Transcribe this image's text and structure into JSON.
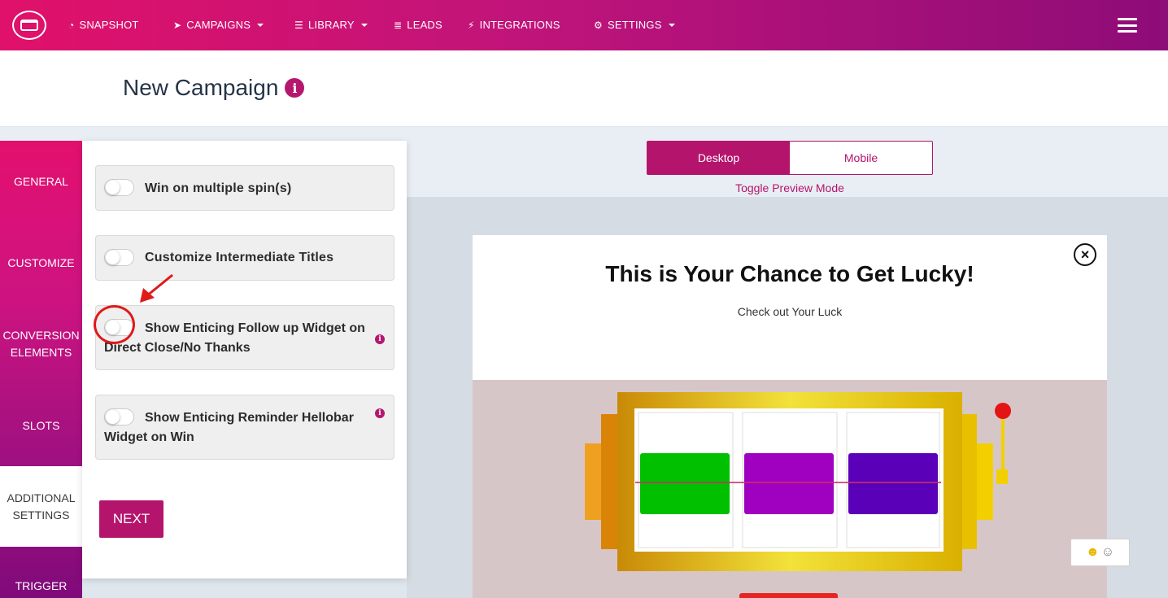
{
  "nav": {
    "items": [
      {
        "label": "SNAPSHOT",
        "icon": "dashboard-icon",
        "dropdown": false
      },
      {
        "label": "CAMPAIGNS",
        "icon": "paper-plane-icon",
        "dropdown": true
      },
      {
        "label": "LIBRARY",
        "icon": "library-icon",
        "dropdown": true
      },
      {
        "label": "LEADS",
        "icon": "list-icon",
        "dropdown": false
      },
      {
        "label": "INTEGRATIONS",
        "icon": "plug-icon",
        "dropdown": false
      },
      {
        "label": "SETTINGS",
        "icon": "cogs-icon",
        "dropdown": true
      }
    ]
  },
  "page": {
    "title": "New Campaign"
  },
  "sidebar": {
    "tabs": [
      {
        "label": "GENERAL",
        "active": false
      },
      {
        "label": "CUSTOMIZE",
        "active": false
      },
      {
        "label": "CONVERSION ELEMENTS",
        "active": false
      },
      {
        "label": "SLOTS",
        "active": false
      },
      {
        "label": "ADDITIONAL SETTINGS",
        "active": true
      },
      {
        "label": "TRIGGER",
        "active": false
      }
    ]
  },
  "settings": {
    "options": [
      {
        "label": "Win on multiple spin(s)",
        "enabled": false,
        "info": false
      },
      {
        "label": "Customize Intermediate Titles",
        "enabled": false,
        "info": false
      },
      {
        "label": "Show Enticing Follow up Widget on Direct Close/No Thanks",
        "enabled": false,
        "info": true
      },
      {
        "label": "Show Enticing Reminder Hellobar Widget on Win",
        "enabled": false,
        "info": true
      }
    ],
    "next_label": "NEXT"
  },
  "preview": {
    "desktop_label": "Desktop",
    "mobile_label": "Mobile",
    "mode": "desktop",
    "caption": "Toggle Preview Mode"
  },
  "popup": {
    "title": "This is Your Chance to Get Lucky!",
    "subtitle": "Check out Your Luck",
    "close_glyph": "×",
    "slot_colors": [
      "#00c000",
      "#a000c0",
      "#5a00b8"
    ]
  },
  "emoji_widget": {
    "glyph": "☺"
  },
  "colors": {
    "accent": "#b5146c",
    "nav_gradient_start": "#e0116a",
    "nav_gradient_end": "#8e0c78",
    "annotation": "#e01919"
  }
}
